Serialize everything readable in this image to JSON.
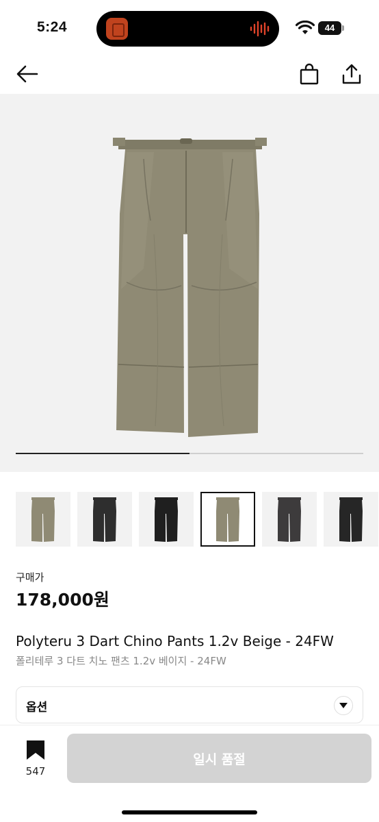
{
  "status_bar": {
    "time": "5:24",
    "battery": "44"
  },
  "nav": {
    "back_icon": "arrow-left-icon",
    "cart_icon": "shopping-bag-icon",
    "share_icon": "share-icon"
  },
  "gallery": {
    "progress": 0.5,
    "thumbnails": [
      {
        "color": "#8f8a74",
        "selected": false
      },
      {
        "color": "#2e2e2e",
        "selected": false
      },
      {
        "color": "#1f1f1f",
        "selected": false
      },
      {
        "color": "#8f8a74",
        "selected": true
      },
      {
        "color": "#3d3b3c",
        "selected": false
      },
      {
        "color": "#262626",
        "selected": false
      }
    ]
  },
  "product": {
    "price_label": "구매가",
    "price": "178,000원",
    "title_en": "Polyteru 3 Dart Chino Pants 1.2v Beige - 24FW",
    "title_ko": "폴리테루 3 다트 치노 팬츠 1.2v 베이지 - 24FW"
  },
  "option": {
    "label": "옵션",
    "toggle_icon": "triangle-down-icon"
  },
  "bottom_bar": {
    "bookmark_count": "547",
    "soldout_label": "일시 품절"
  },
  "colors": {
    "pants_beige": "#8f8a74",
    "hero_background": "#f2f2f2",
    "disabled_button": "#d3d3d3"
  }
}
